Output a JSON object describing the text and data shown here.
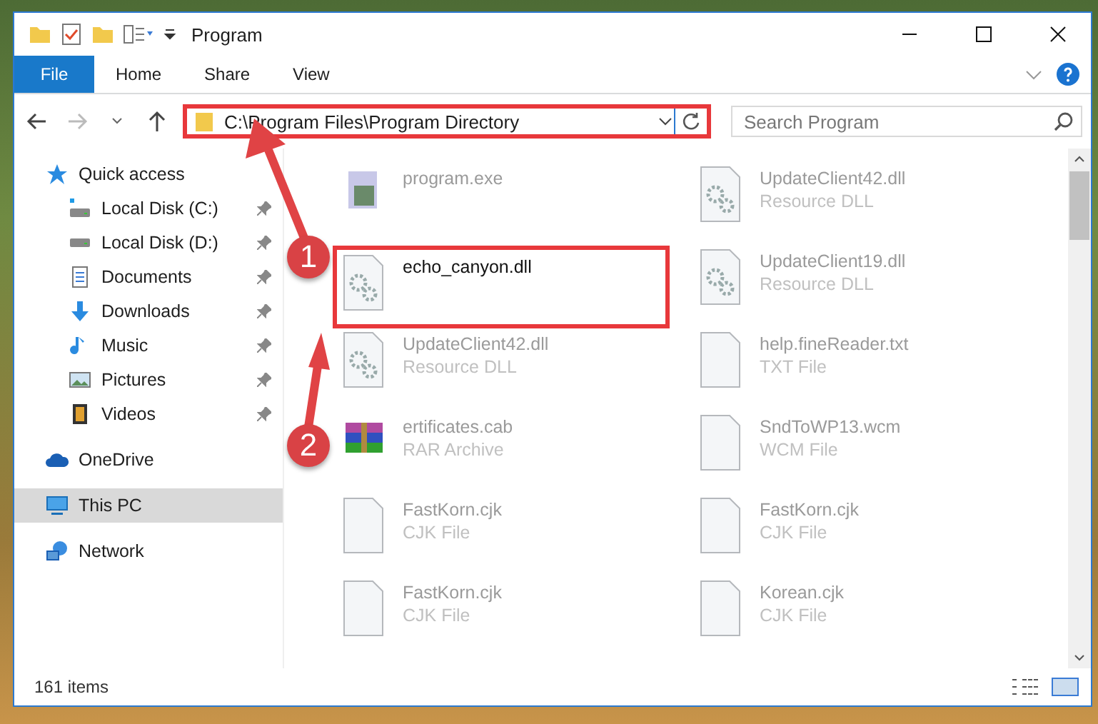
{
  "window": {
    "title": "Program"
  },
  "ribbon": {
    "tabs": [
      {
        "label": "File",
        "selected": true
      },
      {
        "label": "Home",
        "selected": false
      },
      {
        "label": "Share",
        "selected": false
      },
      {
        "label": "View",
        "selected": false
      }
    ]
  },
  "address_bar": {
    "path": "C:\\Program Files\\Program Directory",
    "highlighted": true
  },
  "search": {
    "placeholder": "Search Program"
  },
  "sidebar": {
    "items": [
      {
        "label": "Quick access",
        "kind": "star",
        "selected": false,
        "children": [
          {
            "label": "Local Disk (C:)",
            "kind": "disk-c",
            "pinned": true,
            "selected": false
          },
          {
            "label": "Local Disk (D:)",
            "kind": "disk",
            "pinned": true,
            "selected": false
          },
          {
            "label": "Documents",
            "kind": "documents",
            "pinned": true,
            "selected": false
          },
          {
            "label": "Downloads",
            "kind": "downloads",
            "pinned": true,
            "selected": false
          },
          {
            "label": "Music",
            "kind": "music",
            "pinned": true,
            "selected": false
          },
          {
            "label": "Pictures",
            "kind": "pictures",
            "pinned": true,
            "selected": false
          },
          {
            "label": "Videos",
            "kind": "videos",
            "pinned": true,
            "selected": false
          }
        ]
      },
      {
        "label": "OneDrive",
        "kind": "cloud",
        "selected": false
      },
      {
        "label": "This PC",
        "kind": "pc",
        "selected": true
      },
      {
        "label": "Network",
        "kind": "network",
        "selected": false
      }
    ]
  },
  "files": [
    {
      "name": "program.exe",
      "kind": "exe",
      "highlighted": false
    },
    {
      "name": "UpdateClient42.dll",
      "type": "Resource DLL",
      "kind": "gear",
      "highlighted": false
    },
    {
      "name": "echo_canyon.dll",
      "kind": "gear",
      "highlighted": true
    },
    {
      "name": "UpdateClient19.dll",
      "type": "Resource DLL",
      "kind": "gear",
      "highlighted": false
    },
    {
      "name": "UpdateClient42.dll",
      "type": "Resource DLL",
      "kind": "gear",
      "highlighted": false
    },
    {
      "name": "help.fineReader.txt",
      "type": "TXT File",
      "kind": "blank",
      "highlighted": false
    },
    {
      "name": "ertificates.cab",
      "type": "RAR Archive",
      "kind": "archive",
      "highlighted": false
    },
    {
      "name": "SndToWP13.wcm",
      "type": "WCM File",
      "kind": "blank",
      "highlighted": false
    },
    {
      "name": "FastKorn.cjk",
      "type": "CJK File",
      "kind": "blank",
      "highlighted": false
    },
    {
      "name": "FastKorn.cjk",
      "type": "CJK File",
      "kind": "blank",
      "highlighted": false
    },
    {
      "name": "FastKorn.cjk",
      "type": "CJK File",
      "kind": "blank",
      "highlighted": false
    },
    {
      "name": "Korean.cjk",
      "type": "CJK File",
      "kind": "blank",
      "highlighted": false
    }
  ],
  "status_bar": {
    "count": "161 items"
  },
  "annotations": [
    {
      "number": "1"
    },
    {
      "number": "2"
    }
  ]
}
